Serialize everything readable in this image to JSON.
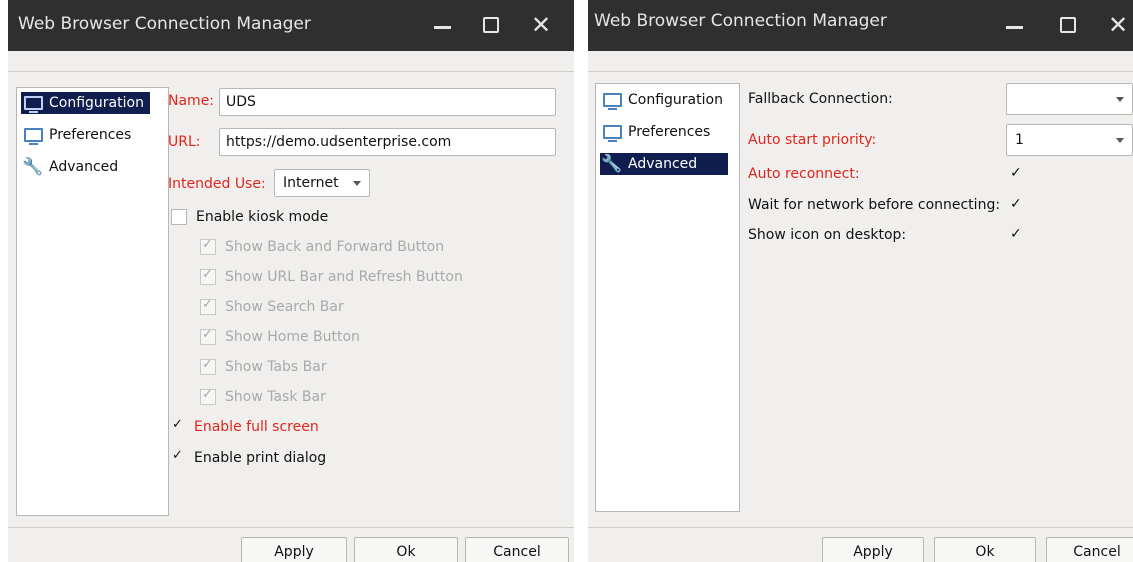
{
  "left_window": {
    "title": "Web Browser Connection Manager",
    "nav": [
      {
        "label": "Configuration",
        "icon": "monitor-icon",
        "selected": true
      },
      {
        "label": "Preferences",
        "icon": "monitor-icon",
        "selected": false
      },
      {
        "label": "Advanced",
        "icon": "wrench-icon",
        "selected": false
      }
    ],
    "form": {
      "name_label": "Name:",
      "name_value": "UDS",
      "url_label": "URL:",
      "url_value": "https://demo.udsenterprise.com",
      "intended_use_label": "Intended Use:",
      "intended_use_value": "Internet"
    },
    "checkboxes": [
      {
        "label": "Enable kiosk mode",
        "checked": false,
        "enabled": true
      },
      {
        "label": "Show Back and Forward Button",
        "checked": true,
        "enabled": false
      },
      {
        "label": "Show URL Bar and Refresh Button",
        "checked": true,
        "enabled": false
      },
      {
        "label": "Show Search Bar",
        "checked": true,
        "enabled": false
      },
      {
        "label": "Show Home Button",
        "checked": true,
        "enabled": false
      },
      {
        "label": "Show Tabs Bar",
        "checked": true,
        "enabled": false
      },
      {
        "label": "Show Task Bar",
        "checked": true,
        "enabled": false
      },
      {
        "label": "Enable full screen",
        "checked": true,
        "enabled": true
      },
      {
        "label": "Enable print dialog",
        "checked": true,
        "enabled": true
      }
    ],
    "buttons": {
      "apply": "Apply",
      "ok": "Ok",
      "cancel": "Cancel"
    }
  },
  "right_window": {
    "title": "Web Browser Connection Manager",
    "nav": [
      {
        "label": "Configuration",
        "icon": "monitor-icon",
        "selected": false
      },
      {
        "label": "Preferences",
        "icon": "monitor-icon",
        "selected": false
      },
      {
        "label": "Advanced",
        "icon": "wrench-icon",
        "selected": true
      }
    ],
    "settings": {
      "fallback_label": "Fallback Connection:",
      "fallback_value": "",
      "priority_label": "Auto start priority:",
      "priority_value": "1",
      "reconnect_label": "Auto reconnect:",
      "reconnect_checked": true,
      "wait_network_label": "Wait for network before connecting:",
      "wait_network_checked": true,
      "show_icon_label": "Show icon on desktop:",
      "show_icon_checked": true
    },
    "buttons": {
      "apply": "Apply",
      "ok": "Ok",
      "cancel": "Cancel"
    }
  },
  "colors": {
    "titlebar": "#2f2f2f",
    "selection": "#0f1e4e",
    "required_label": "#e0261c",
    "panel_bg": "#f0efed"
  }
}
